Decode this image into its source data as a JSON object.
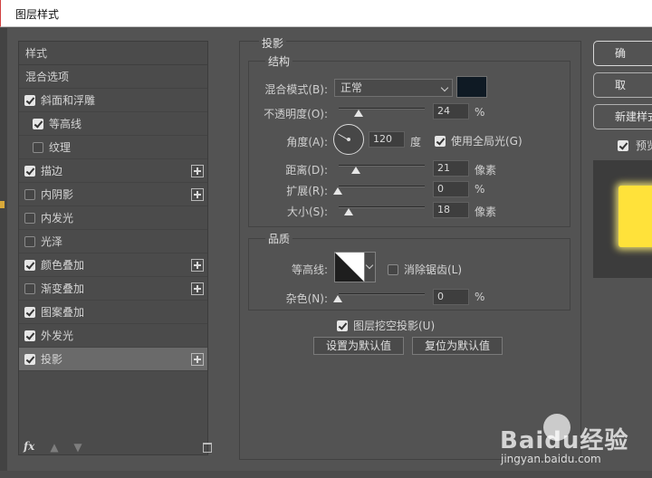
{
  "window": {
    "title": "图层样式"
  },
  "styles_panel": {
    "header": "样式",
    "blend_options": "混合选项",
    "items": [
      {
        "label": "斜面和浮雕",
        "checked": true,
        "indent": false,
        "add": false
      },
      {
        "label": "等高线",
        "checked": true,
        "indent": true,
        "add": false
      },
      {
        "label": "纹理",
        "checked": false,
        "indent": true,
        "add": false
      },
      {
        "label": "描边",
        "checked": true,
        "indent": false,
        "add": true
      },
      {
        "label": "内阴影",
        "checked": false,
        "indent": false,
        "add": true
      },
      {
        "label": "内发光",
        "checked": false,
        "indent": false,
        "add": false
      },
      {
        "label": "光泽",
        "checked": false,
        "indent": false,
        "add": false
      },
      {
        "label": "颜色叠加",
        "checked": true,
        "indent": false,
        "add": true
      },
      {
        "label": "渐变叠加",
        "checked": false,
        "indent": false,
        "add": true
      },
      {
        "label": "图案叠加",
        "checked": true,
        "indent": false,
        "add": false
      },
      {
        "label": "外发光",
        "checked": true,
        "indent": false,
        "add": false
      },
      {
        "label": "投影",
        "checked": true,
        "indent": false,
        "add": true,
        "selected": true
      }
    ],
    "fx_label": "fx"
  },
  "drop_shadow": {
    "section_title": "投影",
    "structure": {
      "title": "结构",
      "blend_mode_label": "混合模式(B):",
      "blend_mode_value": "正常",
      "shadow_color": "#0f1a24",
      "opacity_label": "不透明度(O):",
      "opacity_value": "24",
      "opacity_unit": "%",
      "angle_label": "角度(A):",
      "angle_value": "120",
      "angle_unit": "度",
      "global_light_label": "使用全局光(G)",
      "global_light_checked": true,
      "distance_label": "距离(D):",
      "distance_value": "21",
      "distance_unit": "像素",
      "spread_label": "扩展(R):",
      "spread_value": "0",
      "spread_unit": "%",
      "size_label": "大小(S):",
      "size_value": "18",
      "size_unit": "像素"
    },
    "quality": {
      "title": "品质",
      "contour_label": "等高线:",
      "anti_alias_label": "消除锯齿(L)",
      "anti_alias_checked": false,
      "noise_label": "杂色(N):",
      "noise_value": "0",
      "noise_unit": "%"
    },
    "knockout_label": "图层挖空投影(U)",
    "knockout_checked": true,
    "set_default_label": "设置为默认值",
    "reset_default_label": "复位为默认值"
  },
  "right_panel": {
    "ok_label": "确",
    "cancel_label": "取",
    "new_style_label": "新建样式",
    "preview_label": "预览",
    "preview_checked": true
  },
  "watermark": {
    "brand": "Baidu经验",
    "url": "jingyan.baidu.com"
  }
}
